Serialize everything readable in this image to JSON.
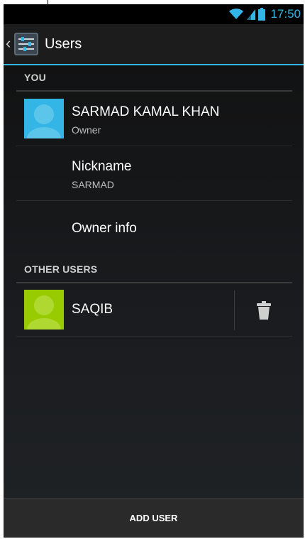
{
  "status_bar": {
    "time": "17:50",
    "accent": "#33b5e5"
  },
  "action_bar": {
    "title": "Users",
    "icon": "settings-sliders-icon"
  },
  "sections": {
    "you": {
      "header": "YOU"
    },
    "other": {
      "header": "OTHER USERS"
    }
  },
  "owner": {
    "name": "SARMAD KAMAL KHAN",
    "role": "Owner",
    "avatar_color": "#33b5e5"
  },
  "nickname": {
    "label": "Nickname",
    "value": "SARMAD"
  },
  "owner_info": {
    "label": "Owner info"
  },
  "users": [
    {
      "name": "SAQIB",
      "avatar_color": "#99cc00",
      "action_icon": "trash-icon"
    }
  ],
  "footer": {
    "add_user_label": "ADD USER"
  }
}
